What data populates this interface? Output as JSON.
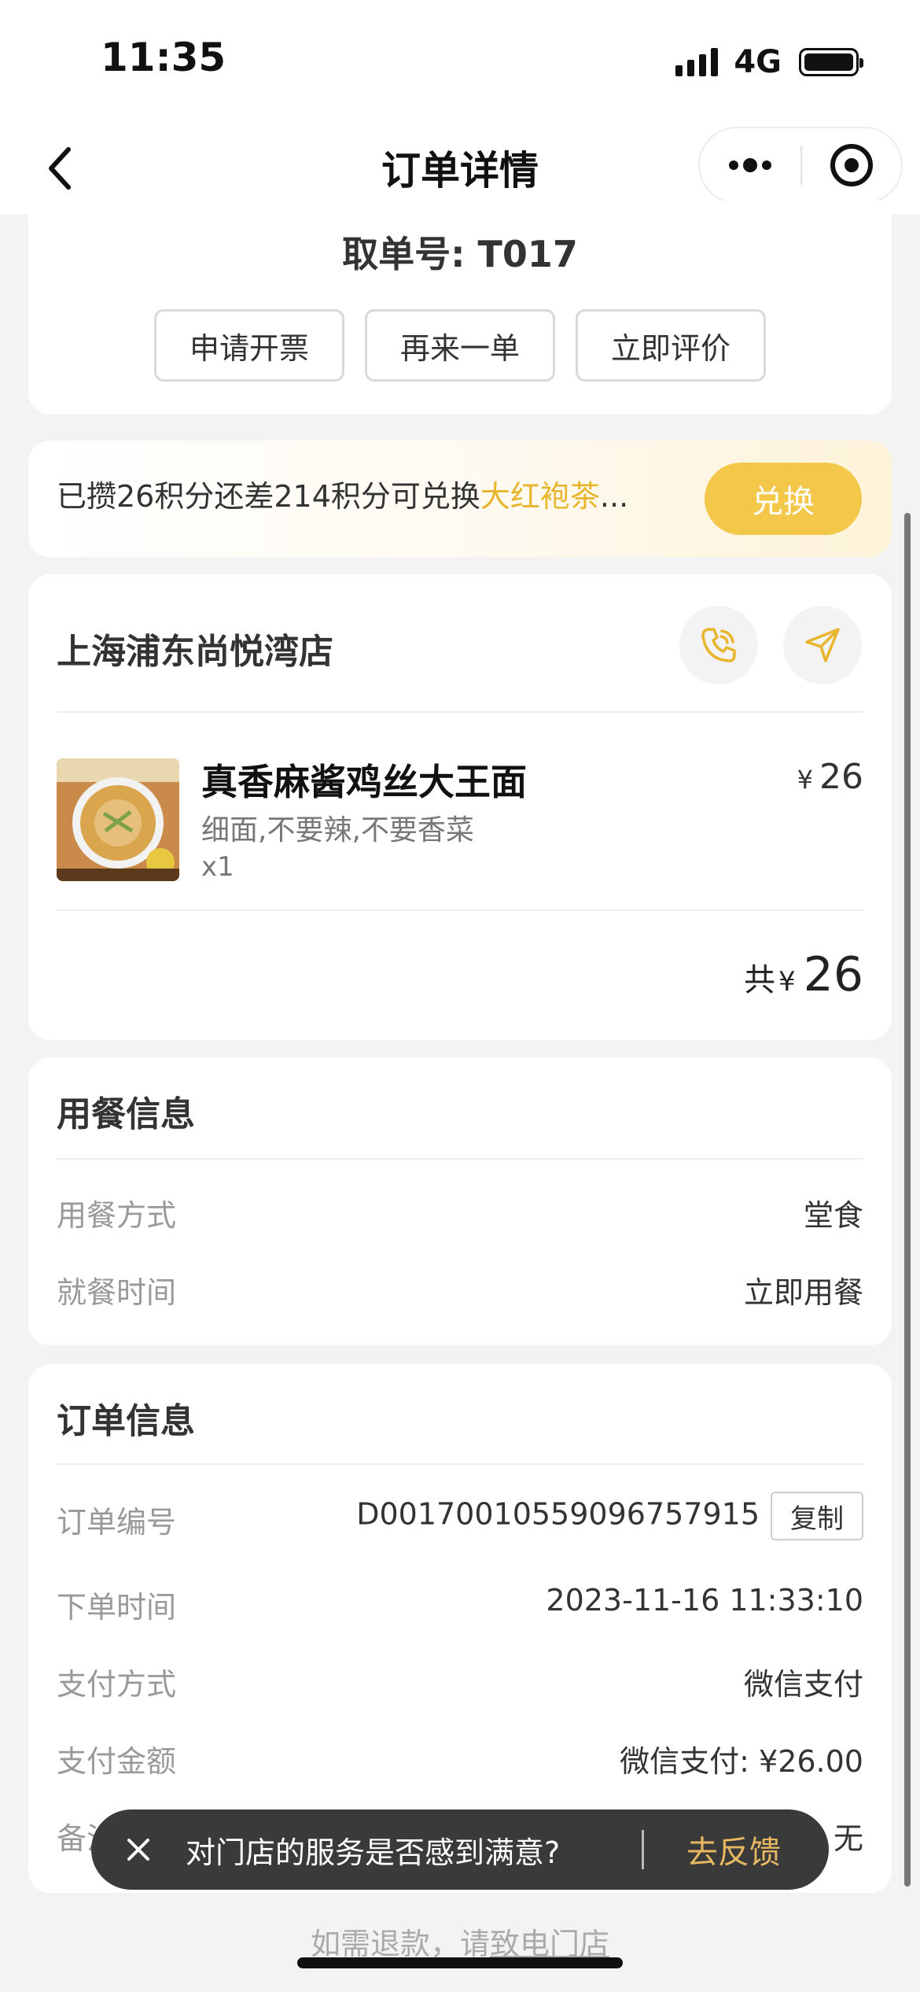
{
  "status_bar": {
    "time": "11:35",
    "network": "4G"
  },
  "nav": {
    "title": "订单详情"
  },
  "order_header": {
    "pickup_number": "取单号: T017",
    "buttons": [
      "申请开票",
      "再来一单",
      "立即评价"
    ]
  },
  "points": {
    "text_prefix": "已攒26积分还差214积分可兑换",
    "highlight": "大红袍茶",
    "text_suffix": "...",
    "redeem_label": "兑换"
  },
  "store": {
    "name": "上海浦东尚悦湾店",
    "item": {
      "name": "真香麻酱鸡丝大王面",
      "spec": "细面,不要辣,不要香菜",
      "qty": "x1",
      "currency": "¥",
      "price": "26"
    },
    "total_label": "共",
    "total_currency": "¥",
    "total": "26"
  },
  "dine_info": {
    "title": "用餐信息",
    "rows": [
      {
        "label": "用餐方式",
        "value": "堂食"
      },
      {
        "label": "就餐时间",
        "value": "立即用餐"
      }
    ]
  },
  "order_info": {
    "title": "订单信息",
    "order_no_label": "订单编号",
    "order_no": "D0017001055909675791​5",
    "copy_label": "复制",
    "rows": [
      {
        "label": "下单时间",
        "value": "2023-11-16 11:33:10"
      },
      {
        "label": "支付方式",
        "value": "微信支付"
      },
      {
        "label": "支付金额",
        "value": "微信支付: ¥26.00"
      },
      {
        "label": "备注信息",
        "value": "无"
      }
    ]
  },
  "toast": {
    "text": "对门店的服务是否感到满意?",
    "action": "去反馈"
  },
  "refund": {
    "prefix": "如需退款，请",
    "link": "致电门店"
  },
  "colors": {
    "accent": "#f3c84a",
    "highlight": "#e8b52c",
    "toast_bg": "#3a3a3a"
  }
}
